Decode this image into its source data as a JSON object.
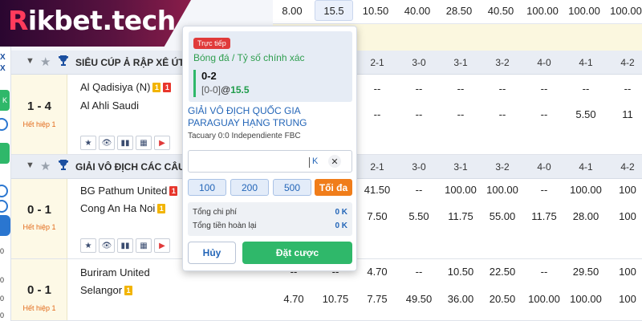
{
  "brand": {
    "prefix": "R",
    "rest": "ikbet.tech"
  },
  "top_odds": [
    "8.00",
    "15.5",
    "10.50",
    "40.00",
    "28.50",
    "40.50",
    "100.00",
    "100.00",
    "100.00"
  ],
  "side_panel": {
    "x1": "X",
    "x2": "X",
    "g1": "K",
    "n1": "0",
    "n2": "0",
    "n3": "0",
    "n4": "0"
  },
  "leagues": [
    {
      "name": "SIÊU CÚP Ả RẬP XÊ ÚT",
      "headers": [
        "2-1",
        "3-0",
        "3-1",
        "3-2",
        "4-0",
        "4-1",
        "4-2"
      ],
      "matches": [
        {
          "score": "1 - 4",
          "period": "Hết hiệp 1",
          "home": "Al Qadisiya (N)",
          "home_badges": [
            {
              "text": "1",
              "kind": "yel"
            },
            {
              "text": "1",
              "kind": "red"
            }
          ],
          "away": "Al Ahli Saudi",
          "away_badges": [],
          "row1": [
            "--",
            "--",
            "--",
            "--",
            "--",
            "--",
            "--"
          ],
          "row2": [
            "--",
            "--",
            "--",
            "--",
            "--",
            "5.50",
            "11"
          ]
        }
      ]
    },
    {
      "name": "GIẢI VÔ ĐỊCH CÁC CÂU LẠC",
      "headers": [
        "2-1",
        "3-0",
        "3-1",
        "3-2",
        "4-0",
        "4-1",
        "4-2"
      ],
      "matches": [
        {
          "score": "0 - 1",
          "period": "Hết hiệp 1",
          "home": "BG Pathum United",
          "home_badges": [
            {
              "text": "1",
              "kind": "red"
            }
          ],
          "away": "Cong An Ha Noi",
          "away_badges": [
            {
              "text": "1",
              "kind": "yel"
            }
          ],
          "row1": [
            "41.50",
            "--",
            "100.00",
            "100.00",
            "--",
            "100.00",
            "100"
          ],
          "row2": [
            "7.50",
            "5.50",
            "11.75",
            "55.00",
            "11.75",
            "28.00",
            "100"
          ]
        },
        {
          "score": "0 - 1",
          "period": "Hết hiệp 1",
          "home": "Buriram United",
          "home_badges": [],
          "away": "Selangor",
          "away_badges": [
            {
              "text": "1",
              "kind": "yel"
            }
          ],
          "row1": [
            "--",
            "--",
            "4.70",
            "--",
            "10.50",
            "22.50",
            "--",
            "29.50",
            "100"
          ],
          "row2": [
            "4.70",
            "10.75",
            "7.75",
            "49.50",
            "36.00",
            "20.50",
            "100.00",
            "100.00",
            "100"
          ]
        }
      ]
    }
  ],
  "bet_slip": {
    "live_label": "Trực tiếp",
    "market": "Bóng đá / Tỷ số chính xác",
    "pick": "0-2",
    "current_score": "[0-0]",
    "at": "@",
    "odds": "15.5",
    "league": "GIẢI VÔ ĐỊCH QUỐC GIA PARAGUAY HẠNG TRUNG",
    "fixture": "Tacuary 0:0 Independiente FBC",
    "stake_value": "",
    "stake_unit": "K",
    "clear": "✕",
    "quick_amounts": [
      "100",
      "200",
      "500"
    ],
    "max_label": "Tối đa",
    "total_cost_label": "Tổng chi phí",
    "total_cost_value": "0 K",
    "total_return_label": "Tổng tiền hoàn lại",
    "total_return_value": "0 K",
    "cancel_label": "Hủy",
    "place_label": "Đặt cược"
  },
  "colors": {
    "accent_green": "#2fb86a",
    "link_blue": "#2466b8",
    "live_red": "#e03a3a",
    "max_orange": "#f07d1a"
  }
}
